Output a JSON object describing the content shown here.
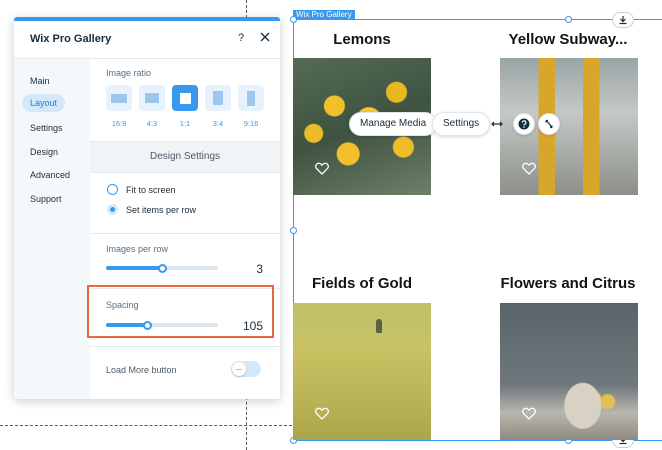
{
  "gallery": {
    "tag": "Wix Pro Gallery",
    "items": [
      {
        "title": "Lemons"
      },
      {
        "title": "Yellow Subway..."
      },
      {
        "title": "Fields of Gold"
      },
      {
        "title": "Flowers and Citrus"
      }
    ],
    "toolbar": {
      "manage_media": "Manage Media",
      "settings": "Settings"
    }
  },
  "panel": {
    "title": "Wix Pro Gallery",
    "help": "?",
    "sidebar": [
      "Main",
      "Layout",
      "Settings",
      "Design",
      "Advanced",
      "Support"
    ],
    "active_tab": "Layout",
    "image_ratio": {
      "label": "Image ratio",
      "options": [
        "16:9",
        "4:3",
        "1:1",
        "3:4",
        "9:16"
      ],
      "selected": "1:1"
    },
    "design_settings": "Design Settings",
    "fit": {
      "options": [
        "Fit to screen",
        "Set items per row"
      ],
      "selected": "Set items per row"
    },
    "images_per_row": {
      "label": "Images per row",
      "value": "3",
      "fraction": 0.5
    },
    "spacing": {
      "label": "Spacing",
      "value": "105",
      "fraction": 0.37
    },
    "load_more": {
      "label": "Load More button",
      "enabled": false
    }
  },
  "colors": {
    "accent": "#3899ec",
    "highlight": "#e8683f"
  }
}
